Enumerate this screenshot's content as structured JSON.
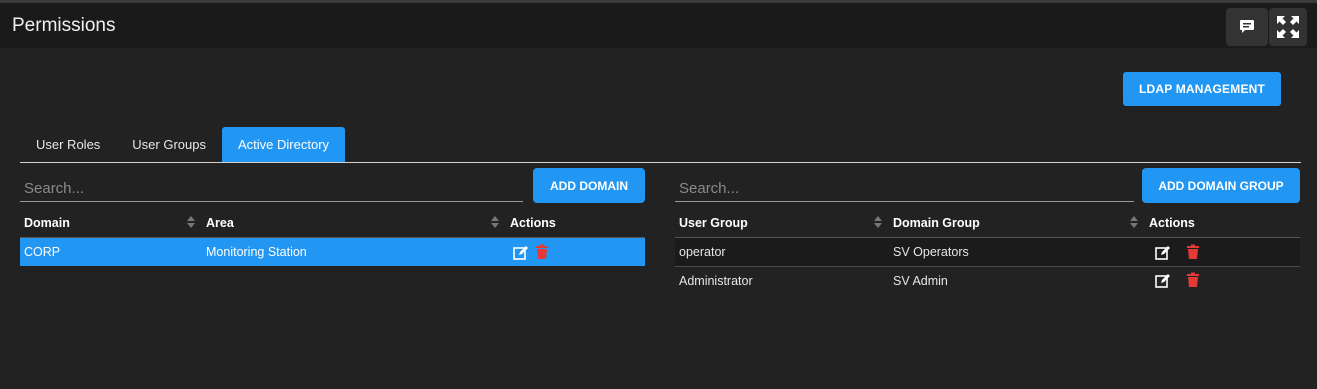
{
  "header": {
    "title": "Permissions",
    "buttons": [
      {
        "name": "comment-button",
        "icon": "chat-icon"
      },
      {
        "name": "fullscreen-button",
        "icon": "fullscreen-icon"
      }
    ]
  },
  "ldap_button": "LDAP MANAGEMENT",
  "tabs": [
    {
      "label": "User Roles",
      "active": false
    },
    {
      "label": "User Groups",
      "active": false
    },
    {
      "label": "Active Directory",
      "active": true
    }
  ],
  "left": {
    "search_placeholder": "Search...",
    "add_button": "ADD DOMAIN",
    "columns": [
      "Domain",
      "Area",
      "Actions"
    ],
    "rows": [
      {
        "domain": "CORP",
        "area": "Monitoring Station",
        "selected": true
      }
    ]
  },
  "right": {
    "search_placeholder": "Search...",
    "add_button": "ADD DOMAIN GROUP",
    "columns": [
      "User Group",
      "Domain Group",
      "Actions"
    ],
    "rows": [
      {
        "user_group": "operator",
        "domain_group": "SV Operators"
      },
      {
        "user_group": "Administrator",
        "domain_group": "SV Admin"
      }
    ]
  },
  "colors": {
    "accent": "#2196f3",
    "delete": "#e53935",
    "background": "#222222",
    "header": "#1a1a1a"
  }
}
